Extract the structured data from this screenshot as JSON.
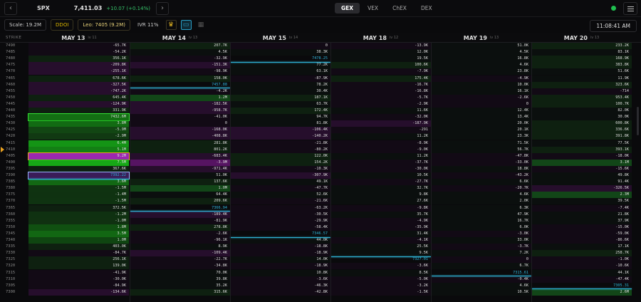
{
  "topbar": {
    "ticker": "SPX",
    "price": "7,411.03",
    "change": "+10.07 (+0.14%)",
    "modes": [
      "GEX",
      "VEX",
      "ChEX",
      "DEX"
    ],
    "active_mode": "GEX"
  },
  "toolbar": {
    "scale": "Scale: 19.2M",
    "ddoi": "DDOI",
    "leo": "Leo: 7405 (9.2M)",
    "ivr": "IVR 11%",
    "time": "11:08:41 AM"
  },
  "header": {
    "strike_label": "STRIKE",
    "dates": [
      {
        "label": "MAY 13",
        "sub": "iv 11"
      },
      {
        "label": "MAY 14",
        "sub": "iv 13"
      },
      {
        "label": "MAY 15",
        "sub": "iv 14"
      },
      {
        "label": "MAY 18",
        "sub": "iv 12"
      },
      {
        "label": "MAY 19",
        "sub": "iv 13"
      },
      {
        "label": "MAY 20",
        "sub": "iv 13"
      }
    ]
  },
  "colors": {
    "green": "#19c219",
    "purple": "#9c27b0",
    "spot": "#2fb4d8",
    "marker": "#e8a020"
  },
  "spot_markers": [
    {
      "col": 0,
      "after_strike": "7390",
      "label": "7392.22"
    },
    {
      "col": 1,
      "after_strike": "7460",
      "label": "7457.88"
    },
    {
      "col": 1,
      "after_strike": "7365",
      "label": "7366.94"
    },
    {
      "col": 2,
      "after_strike": "7480",
      "label": "7478.25"
    },
    {
      "col": 2,
      "after_strike": "7345",
      "label": "7346.57"
    },
    {
      "col": 3,
      "after_strike": "7330",
      "label": "7327.01"
    },
    {
      "col": 4,
      "after_strike": "7315",
      "label": "7315.61"
    },
    {
      "col": 5,
      "after_strike": "7305",
      "label": "7305.31"
    }
  ],
  "current_strike": "7410",
  "rows": [
    {
      "strike": "7490",
      "v": [
        "-65.7K",
        "207.7K",
        "0",
        "-13.9K",
        "51.0K",
        "233.2K"
      ]
    },
    {
      "strike": "7485",
      "v": [
        "-54.2K",
        "4.5K",
        "38.3K",
        "12.0K",
        "4.5K",
        "83.1K"
      ]
    },
    {
      "strike": "7480",
      "v": [
        "356.1K",
        "-32.9K",
        "7478.25",
        "19.5K",
        "16.8K",
        "168.9K"
      ]
    },
    {
      "strike": "7475",
      "v": [
        "-209.8K",
        "-151.3K",
        "77.2K",
        "100.6K",
        "4.6K",
        "383.8K"
      ]
    },
    {
      "strike": "7470",
      "v": [
        "-255.1K",
        "-98.9K",
        "63.1K",
        "-7.9K",
        "23.8K",
        "51.6K"
      ]
    },
    {
      "strike": "7465",
      "v": [
        "678.6K",
        "158.0K",
        "-87.9K",
        "175.4K",
        "-4.9K",
        "11.9K"
      ]
    },
    {
      "strike": "7460",
      "v": [
        "-327.5K",
        "7457.88",
        "78.2K",
        "-16.7K",
        "10.0K",
        "323.6K"
      ]
    },
    {
      "strike": "7455",
      "v": [
        "-747.2K",
        "-4.2K",
        "30.4K",
        "-16.8K",
        "16.1K",
        "-714"
      ]
    },
    {
      "strike": "7450",
      "v": [
        "645.4K",
        "1.2M",
        "187.1K",
        "-5.7K",
        "-2.6K",
        "953.4K"
      ]
    },
    {
      "strike": "7445",
      "v": [
        "-124.9K",
        "-182.5K",
        "63.7K",
        "-2.9K",
        "0",
        "100.7K"
      ]
    },
    {
      "strike": "7440",
      "v": [
        "331.9K",
        "-958.7K",
        "172.4K",
        "11.6K",
        "12.4K",
        "82.0K"
      ]
    },
    {
      "strike": "7435",
      "v": [
        "7432.6M",
        "-41.0K",
        "94.7K",
        "-32.0K",
        "13.4K",
        "30.0K"
      ]
    },
    {
      "strike": "7430",
      "v": [
        "3.8M",
        "0",
        "81.8K",
        "-187.9K",
        "20.0K",
        "600.8K"
      ]
    },
    {
      "strike": "7425",
      "v": [
        "-5.9M",
        "-168.0K",
        "-106.4K",
        "-291",
        "20.1K",
        "336.6K"
      ]
    },
    {
      "strike": "7420",
      "v": [
        "-2.9M",
        "-408.8K",
        "-140.2K",
        "11.2K",
        "23.3K",
        "391.8K"
      ]
    },
    {
      "strike": "7415",
      "v": [
        "6.4M",
        "281.8K",
        "-21.8K",
        "-8.9K",
        "71.5K",
        "77.5K"
      ]
    },
    {
      "strike": "7410",
      "v": [
        "5.1M",
        "801.2K",
        "-80.2K",
        "-9.0K",
        "56.7K",
        "393.1K"
      ]
    },
    {
      "strike": "7405",
      "v": [
        "9.2M",
        "-683.4K",
        "122.0K",
        "11.2K",
        "-47.8K",
        "-18.0K"
      ]
    },
    {
      "strike": "7400",
      "v": [
        "7.5M",
        "-3.9M",
        "154.2K",
        "-37.7K",
        "-33.0K",
        "3.1M"
      ]
    },
    {
      "strike": "7395",
      "v": [
        "367.6K",
        "-971.4K",
        "-10.3K",
        "-30.0K",
        "18.8K",
        "-15.6K"
      ]
    },
    {
      "strike": "7390",
      "v": [
        "7392.22",
        "51.0K",
        "-307.9K",
        "10.5K",
        "-43.2K",
        "49.8K"
      ]
    },
    {
      "strike": "7385",
      "v": [
        "3.6M",
        "137.6K",
        "49.1K",
        "-27.7K",
        "6.6K",
        "91.4K"
      ]
    },
    {
      "strike": "7380",
      "v": [
        "-1.5M",
        "1.0M",
        "-47.7K",
        "32.7K",
        "-20.7K",
        "-326.5K"
      ]
    },
    {
      "strike": "7375",
      "v": [
        "-1.4M",
        "64.4K",
        "52.6K",
        "9.8K",
        "4.6K",
        "2.3M"
      ]
    },
    {
      "strike": "7370",
      "v": [
        "-1.5M",
        "209.6K",
        "-21.6K",
        "27.6K",
        "2.0K",
        "39.5K"
      ]
    },
    {
      "strike": "7365",
      "v": [
        "372.5K",
        "7366.94",
        "-63.2K",
        "-9.8K",
        "6.3K",
        "-7.4K"
      ]
    },
    {
      "strike": "7360",
      "v": [
        "-1.2M",
        "-189.4K",
        "-30.5K",
        "35.7K",
        "47.9K",
        "21.8K"
      ]
    },
    {
      "strike": "7355",
      "v": [
        "-1.0M",
        "-81.9K",
        "-29.9K",
        "-4.9K",
        "16.7K",
        "37.9K"
      ]
    },
    {
      "strike": "7350",
      "v": [
        "1.8M",
        "278.8K",
        "-58.4K",
        "-35.9K",
        "6.0K",
        "-15.0K"
      ]
    },
    {
      "strike": "7345",
      "v": [
        "3.5M",
        "-2.6K",
        "7346.57",
        "31.4K",
        "-3.0K",
        "-59.0K"
      ]
    },
    {
      "strike": "7340",
      "v": [
        "1.0M",
        "-96.1K",
        "44.0K",
        "-4.1K",
        "33.0K",
        "-86.6K"
      ]
    },
    {
      "strike": "7335",
      "v": [
        "403.0K",
        "8.9K",
        "-18.8K",
        "25.5K",
        "-3.7K",
        "17.1K"
      ]
    },
    {
      "strike": "7330",
      "v": [
        "-84.7K",
        "-109.4K",
        "-18.9K",
        "9.5K",
        "7.2K",
        "258.7K"
      ]
    },
    {
      "strike": "7325",
      "v": [
        "256.1K",
        "-22.7K",
        "14.0K",
        "7327.01",
        "0",
        "-1.0K"
      ]
    },
    {
      "strike": "7320",
      "v": [
        "139.0K",
        "-34.8K",
        "-18.9K",
        "-3.6K",
        "6.7K",
        "-10.6K"
      ]
    },
    {
      "strike": "7315",
      "v": [
        "-41.9K",
        "70.0K",
        "10.8K",
        "8.5K",
        "7315.61",
        "44.1K"
      ]
    },
    {
      "strike": "7310",
      "v": [
        "-30.0K",
        "39.8K",
        "-3.6K",
        "-5.0K",
        "-0.4K",
        "-47.4K"
      ]
    },
    {
      "strike": "7305",
      "v": [
        "-84.9K",
        "35.2K",
        "-46.3K",
        "-3.2K",
        "4.6K",
        "7305.31"
      ]
    },
    {
      "strike": "7300",
      "v": [
        "-134.6K",
        "315.6K",
        "-42.8K",
        "-1.5K",
        "10.5K",
        "2.6M"
      ]
    }
  ]
}
